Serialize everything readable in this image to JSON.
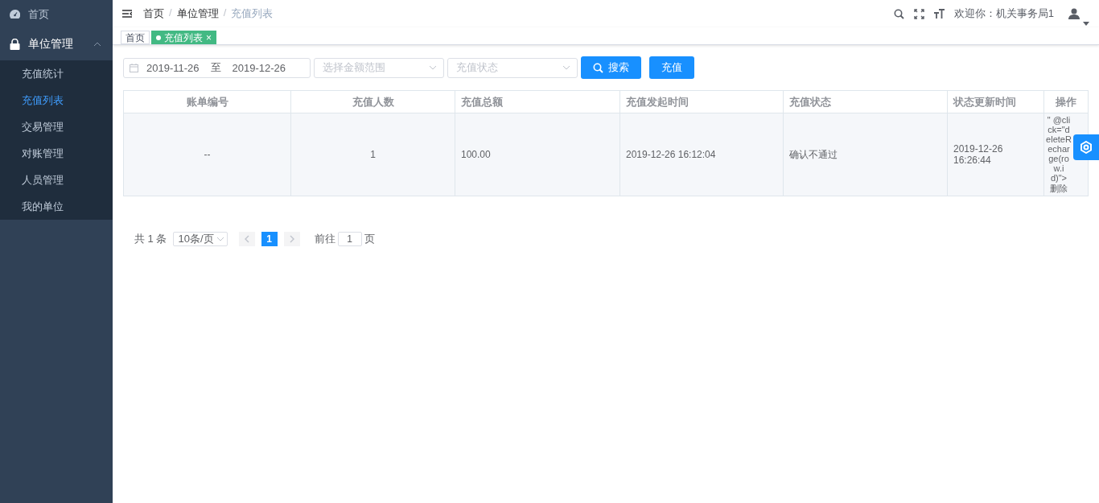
{
  "sidebar": {
    "items": [
      {
        "kind": "link",
        "label": "首页",
        "selected": false
      },
      {
        "kind": "group",
        "label": "单位管理",
        "expanded": true,
        "children": [
          {
            "label": "充值统计",
            "selected": false
          },
          {
            "label": "充值列表",
            "selected": true
          },
          {
            "label": "交易管理",
            "selected": false
          },
          {
            "label": "对账管理",
            "selected": false
          },
          {
            "label": "人员管理",
            "selected": false
          },
          {
            "label": "我的单位",
            "selected": false
          }
        ]
      }
    ]
  },
  "navbar": {
    "breadcrumb": [
      "首页",
      "单位管理",
      "充值列表"
    ],
    "breadcrumb_separator": "/",
    "welcome": "欢迎你：机关事务局1"
  },
  "tags": [
    {
      "label": "首页",
      "selected": false,
      "closable": false
    },
    {
      "label": "充值列表",
      "selected": true,
      "closable": true,
      "close": "×"
    }
  ],
  "filters": {
    "date_start": "2019-11-26",
    "date_separator": "至",
    "date_end": "2019-12-26",
    "amount_placeholder": "选择金额范围",
    "status_placeholder": "充值状态",
    "search_button": "搜索",
    "recharge_button": "充值"
  },
  "table": {
    "columns": [
      "账单编号",
      "充值人数",
      "充值总额",
      "充值发起时间",
      "充值状态",
      "状态更新时间",
      "操作"
    ],
    "rows": [
      {
        "cells": [
          "--",
          "1",
          "100.00",
          "2019-12-26 16:12:04",
          "确认不通过",
          "2019-12-26 16:26:44",
          "\" @click=\"deleteRecharge(row.id)\"> 删除"
        ]
      }
    ]
  },
  "pagination": {
    "total": "共 1 条",
    "page_size": "10条/页",
    "pages": [
      {
        "label": "1",
        "selected": true
      }
    ],
    "goto_label": "前往",
    "goto_value": "1",
    "goto_suffix": "页"
  }
}
